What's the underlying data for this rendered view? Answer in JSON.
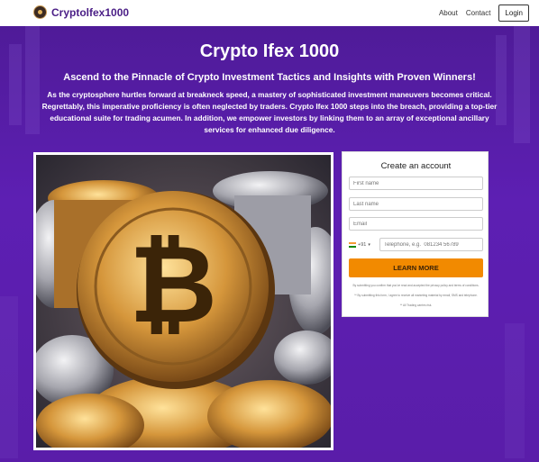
{
  "header": {
    "brand": "Cryptolfex1000",
    "nav": {
      "about": "About",
      "contact": "Contact",
      "login": "Login"
    }
  },
  "hero": {
    "title": "Crypto Ifex 1000",
    "subtitle": "Ascend to the Pinnacle of Crypto Investment Tactics and Insights with Proven Winners!",
    "description": "As the cryptosphere hurtles forward at breakneck speed, a mastery of sophisticated investment maneuvers becomes critical. Regrettably, this imperative proficiency is often neglected by traders. Crypto Ifex 1000 steps into the breach, providing a top-tier educational suite for trading acumen. In addition, we empower investors by linking them to an array of exceptional ancillary services for enhanced due diligence."
  },
  "form": {
    "title": "Create an account",
    "first_name": "First name",
    "last_name": "Last name",
    "email": "Email",
    "country_code": "+91",
    "phone_placeholder": "Telephone, e.g.  081234 56789",
    "submit": "LEARN MORE",
    "legal": [
      "By submitting you confirm that you've read and accepted the privacy policy and terms of conditions.",
      "** By submitting this form, I agree to receive all marketing material by email, SMS and telephone.",
      "** All Trading carries risk."
    ]
  },
  "colors": {
    "brand_purple": "#5a1da9",
    "cta_orange": "#f28a00"
  },
  "icons": {
    "logo": "bitcoin-coin-icon",
    "flag": "india-flag-icon",
    "dropdown": "caret-down-icon"
  }
}
